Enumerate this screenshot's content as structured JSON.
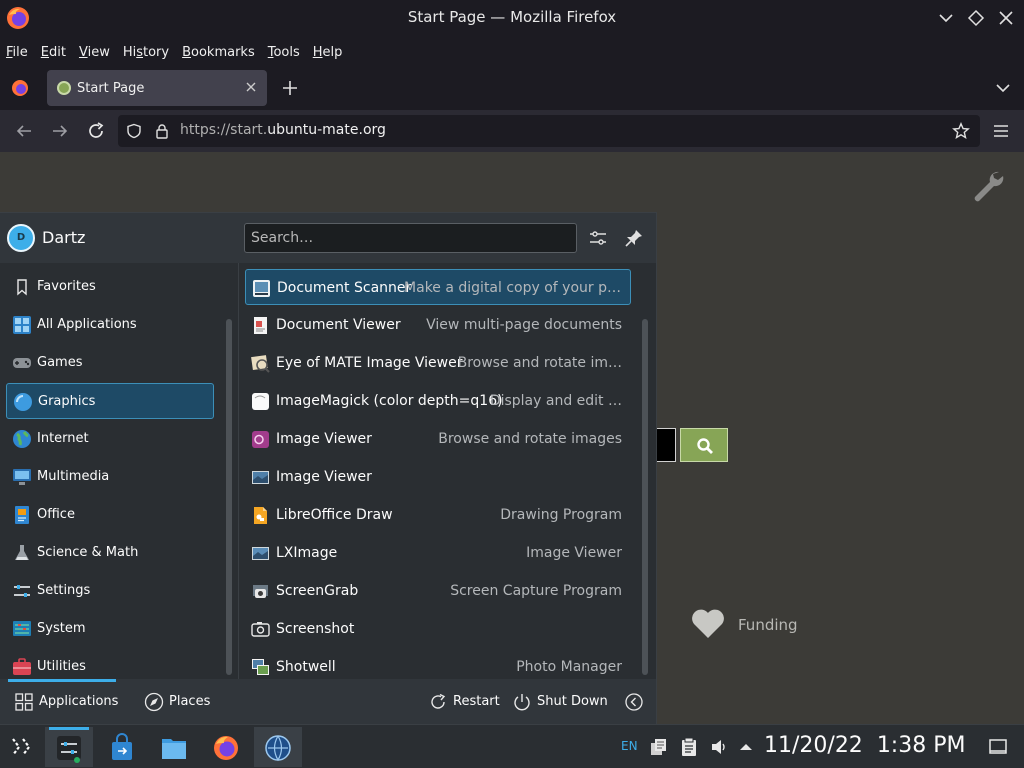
{
  "window": {
    "title": "Start Page — Mozilla Firefox"
  },
  "menubar": {
    "items": [
      {
        "pre": "",
        "u": "F",
        "post": "ile"
      },
      {
        "pre": "",
        "u": "E",
        "post": "dit"
      },
      {
        "pre": "",
        "u": "V",
        "post": "iew"
      },
      {
        "pre": "Hi",
        "u": "s",
        "post": "tory"
      },
      {
        "pre": "",
        "u": "B",
        "post": "ookmarks"
      },
      {
        "pre": "",
        "u": "T",
        "post": "ools"
      },
      {
        "pre": "",
        "u": "H",
        "post": "elp"
      }
    ]
  },
  "tabs": [
    {
      "label": "Start Page",
      "active": true
    }
  ],
  "urlbar": {
    "prefix": "https://start.",
    "domain": "ubuntu-mate.org"
  },
  "page": {
    "funding_label": "Funding"
  },
  "launcher": {
    "user": {
      "name": "Dartz",
      "initial": "D"
    },
    "search_placeholder": "Search…",
    "categories": [
      {
        "label": "Favorites",
        "icon": "bookmark-icon",
        "selected": false
      },
      {
        "label": "All Applications",
        "icon": "grid-icon",
        "selected": false
      },
      {
        "label": "Games",
        "icon": "gamepad-icon",
        "selected": false
      },
      {
        "label": "Graphics",
        "icon": "graphics-icon",
        "selected": true
      },
      {
        "label": "Internet",
        "icon": "globe-icon",
        "selected": false
      },
      {
        "label": "Multimedia",
        "icon": "multimedia-icon",
        "selected": false
      },
      {
        "label": "Office",
        "icon": "office-icon",
        "selected": false
      },
      {
        "label": "Science & Math",
        "icon": "flask-icon",
        "selected": false
      },
      {
        "label": "Settings",
        "icon": "settings-icon",
        "selected": false
      },
      {
        "label": "System",
        "icon": "system-icon",
        "selected": false
      },
      {
        "label": "Utilities",
        "icon": "utilities-icon",
        "selected": false
      }
    ],
    "apps": [
      {
        "name": "Document Scanner",
        "desc": "Make a digital copy of your p…",
        "icon": "scanner-icon",
        "selected": true
      },
      {
        "name": "Document Viewer",
        "desc": "View multi-page documents",
        "icon": "document-viewer-icon",
        "selected": false
      },
      {
        "name": "Eye of MATE Image Viewer",
        "desc": "Browse and rotate im…",
        "icon": "eye-of-mate-icon",
        "selected": false
      },
      {
        "name": "ImageMagick (color depth=q16)",
        "desc": "Display and edit …",
        "icon": "imagemagick-icon",
        "selected": false
      },
      {
        "name": "Image Viewer",
        "desc": "Browse and rotate images",
        "icon": "image-viewer-icon",
        "selected": false
      },
      {
        "name": "Image Viewer",
        "desc": "",
        "icon": "image-viewer-alt-icon",
        "selected": false
      },
      {
        "name": "LibreOffice Draw",
        "desc": "Drawing Program",
        "icon": "libreoffice-draw-icon",
        "selected": false
      },
      {
        "name": "LXImage",
        "desc": "Image Viewer",
        "icon": "lximage-icon",
        "selected": false
      },
      {
        "name": "ScreenGrab",
        "desc": "Screen Capture Program",
        "icon": "screengrab-icon",
        "selected": false
      },
      {
        "name": "Screenshot",
        "desc": "",
        "icon": "screenshot-icon",
        "selected": false
      },
      {
        "name": "Shotwell",
        "desc": "Photo Manager",
        "icon": "shotwell-icon",
        "selected": false
      }
    ],
    "footer": {
      "applications": "Applications",
      "places": "Places",
      "restart": "Restart",
      "shutdown": "Shut Down"
    }
  },
  "panel": {
    "lang": "EN",
    "date": "11/20/22",
    "time": "1:38 PM"
  },
  "colors": {
    "accent": "#3daee9",
    "selection": "#1e4a66",
    "ubuntu_mate_green": "#87a556"
  }
}
